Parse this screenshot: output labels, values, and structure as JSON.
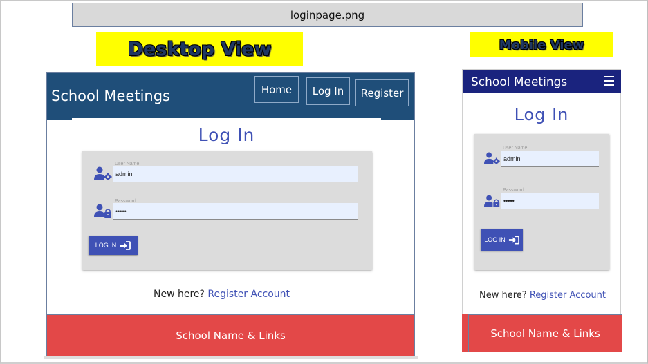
{
  "filename": "loginpage.png",
  "labels": {
    "desktop": "Desktop View",
    "mobile": "Mobile View"
  },
  "desktop": {
    "brand": "School Meetings",
    "nav": {
      "home": "Home",
      "login": "Log In",
      "register": "Register"
    },
    "title": "Log In",
    "username": {
      "label": "User Name",
      "value": "admin"
    },
    "password": {
      "label": "Password",
      "value": "•••••"
    },
    "login_button": "LOG IN",
    "new_here": "New here?",
    "register_link": "Register Account",
    "footer": "School Name & Links"
  },
  "mobile": {
    "brand": "School Meetings",
    "title": "Log In",
    "username": {
      "label": "User Name",
      "value": "admin"
    },
    "password": {
      "label": "Password",
      "value": "•••••"
    },
    "login_button": "LOG IN",
    "new_here": "New here?",
    "register_link": "Register Account",
    "footer": "School Name & Links"
  },
  "icons": {
    "user": "user-cog-icon",
    "lock": "user-lock-icon",
    "login": "sign-in-icon",
    "menu": "hamburger-menu-icon"
  },
  "colors": {
    "desktop_nav": "#1f4e79",
    "mobile_nav": "#1a237e",
    "accent": "#3f51b5",
    "footer": "#e34848",
    "label_bg": "#ffff00",
    "form_bg": "#dcdcdc"
  }
}
